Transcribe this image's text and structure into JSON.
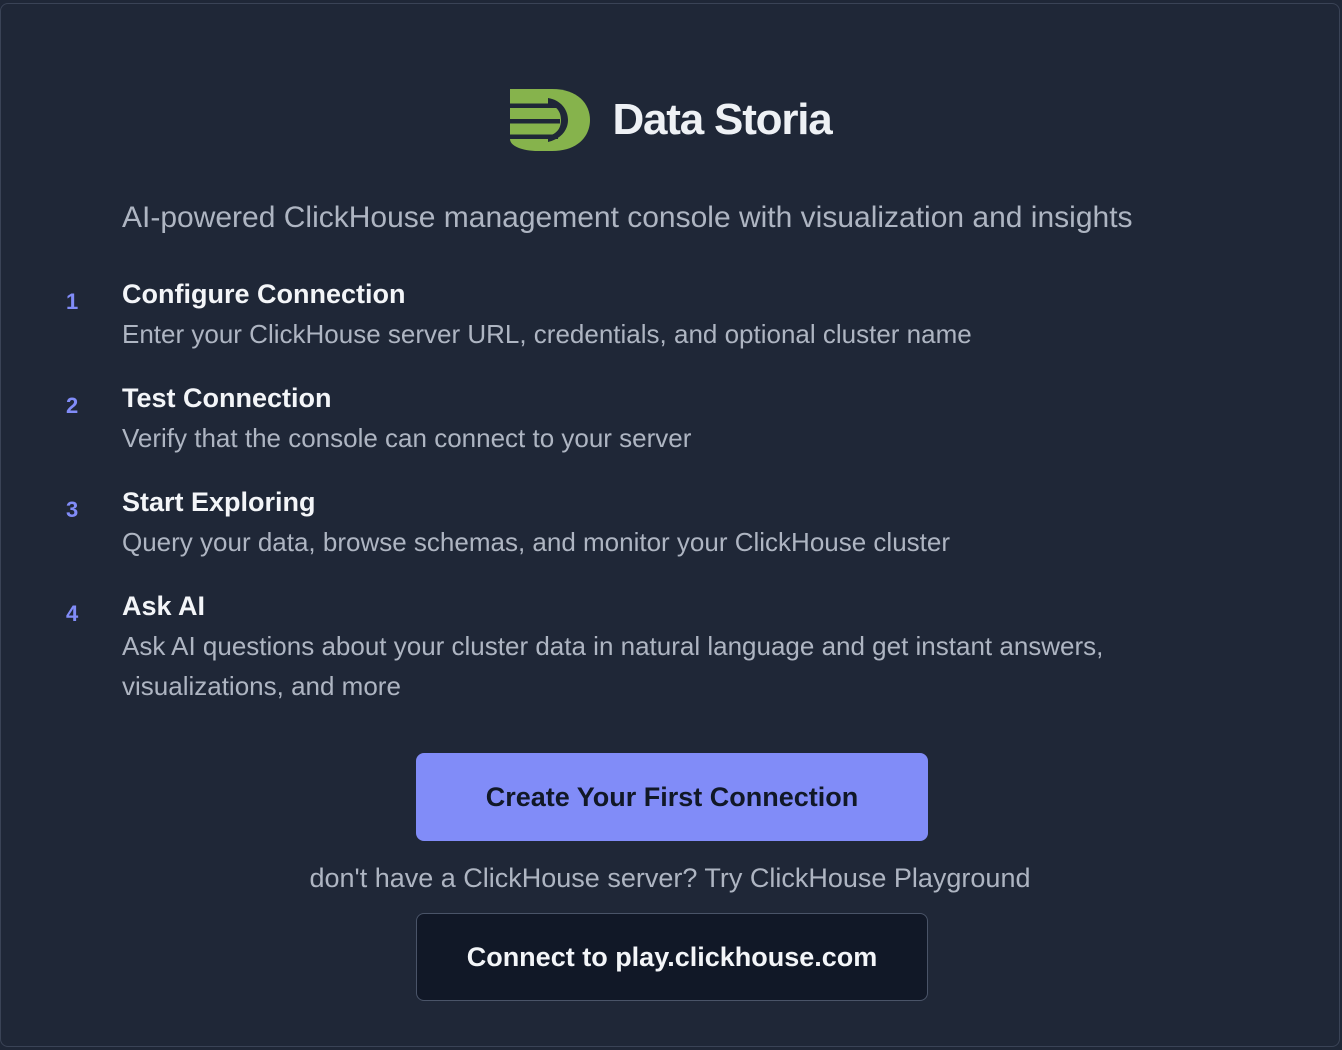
{
  "header": {
    "logo_icon": "database-d-logo-icon",
    "app_title": "Data Storia",
    "logo_color": "#86b34c"
  },
  "tagline": "AI-powered ClickHouse management console with visualization and insights",
  "steps": [
    {
      "number": "1",
      "title": "Configure Connection",
      "description": "Enter your ClickHouse server URL, credentials, and optional cluster name"
    },
    {
      "number": "2",
      "title": "Test Connection",
      "description": "Verify that the console can connect to your server"
    },
    {
      "number": "3",
      "title": "Start Exploring",
      "description": "Query your data, browse schemas, and monitor your ClickHouse cluster"
    },
    {
      "number": "4",
      "title": "Ask AI",
      "description": "Ask AI questions about your cluster data in natural language and get instant answers, visualizations, and more"
    }
  ],
  "actions": {
    "create_connection_label": "Create Your First Connection",
    "playground_hint": "don't have a ClickHouse server? Try ClickHouse Playground",
    "playground_button_label": "Connect to play.clickhouse.com"
  },
  "colors": {
    "background": "#1f2737",
    "accent": "#818cf8",
    "step_number": "#818cf8",
    "secondary_button_bg": "#111827"
  }
}
